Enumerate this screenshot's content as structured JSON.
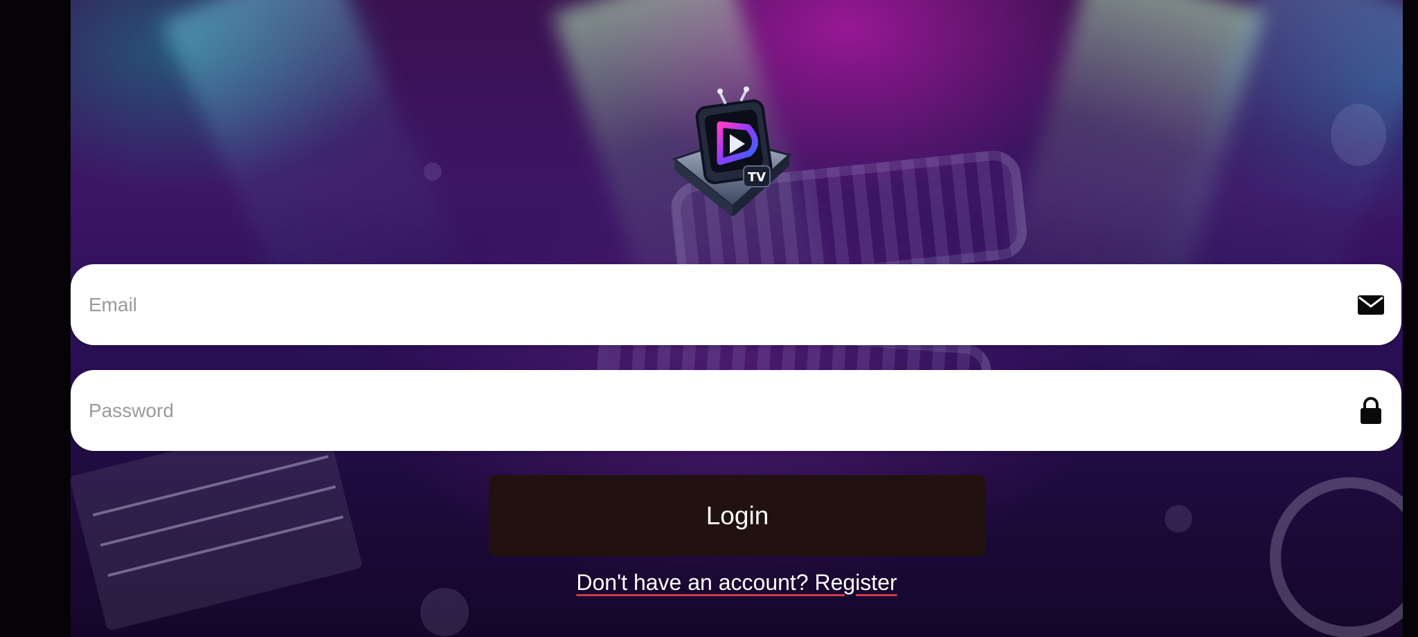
{
  "form": {
    "email_placeholder": "Email",
    "email_icon": "envelope-icon",
    "password_placeholder": "Password",
    "password_icon": "lock-icon",
    "login_label": "Login",
    "register_prompt": "Don't have an account? Register"
  },
  "colors": {
    "field_background": "#ffffff",
    "login_button": "#21120f",
    "link_underline": "#d23a4c"
  }
}
